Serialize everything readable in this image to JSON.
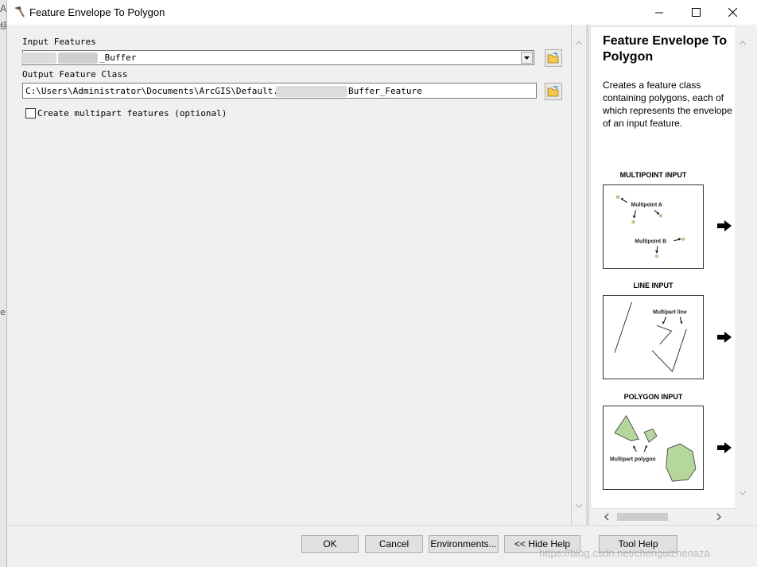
{
  "window": {
    "title": "Feature Envelope To Polygon",
    "controls": {
      "minimize": "—",
      "maximize": "☐",
      "close": "✕"
    }
  },
  "left_strip": {
    "t1": "A",
    "t2": "绕",
    "t3": "e"
  },
  "form": {
    "input_features": {
      "label": "Input Features",
      "value": "_Buffer"
    },
    "output_feature_class": {
      "label": "Output Feature Class",
      "value_prefix": "C:\\Users\\Administrator\\Documents\\ArcGIS\\Default.gdb\\",
      "value_suffix": "Buffer_Feature"
    },
    "multipart": {
      "label": "Create multipart features (optional)",
      "checked": false
    }
  },
  "help": {
    "title": "Feature Envelope To Polygon",
    "description": "Creates a feature class containing polygons, each of which represents the envelope of an input feature.",
    "sections": [
      {
        "label": "MULTIPOINT INPUT",
        "annotations": [
          "Multipoint A",
          "Multipoint B"
        ]
      },
      {
        "label": "LINE INPUT",
        "annotations": [
          "Multipart line"
        ]
      },
      {
        "label": "POLYGON INPUT",
        "annotations": [
          "Multipart polygon"
        ]
      }
    ]
  },
  "buttons": {
    "ok": "OK",
    "cancel": "Cancel",
    "environments": "Environments...",
    "hide_help": "<< Hide Help",
    "tool_help": "Tool Help"
  },
  "watermark": "https://blog.csdn.net/chenguizhenaza",
  "colors": {
    "point_green": "#a8d08d",
    "polygon_fill": "#b5d69c",
    "folder_yellow": "#f2c94c"
  }
}
